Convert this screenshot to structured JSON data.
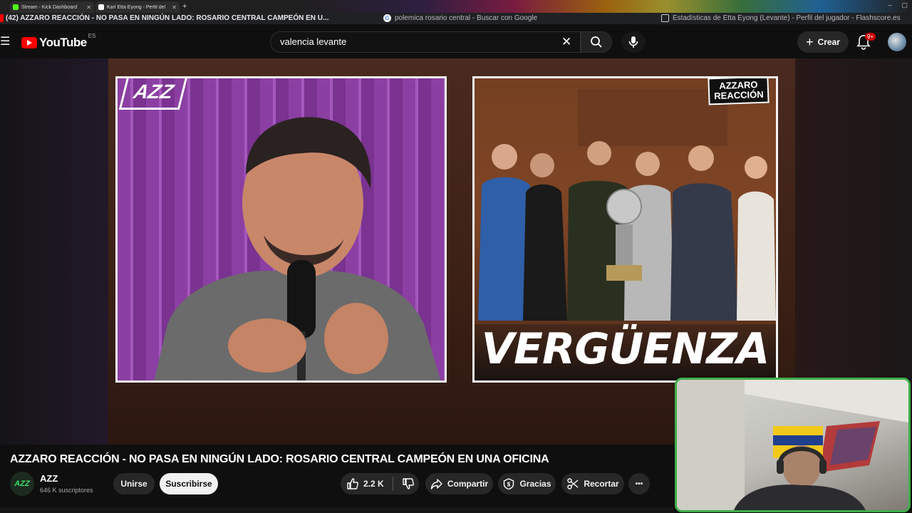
{
  "browser": {
    "tabs": [
      {
        "label": "Stream - Kick Dashboard",
        "color": "#53fc18"
      },
      {
        "label": "Karl Etta Eyong - Perfil del jugador",
        "color": "#ffffff"
      }
    ],
    "new_tab": "+",
    "row2": [
      {
        "label": "(42) AZZARO REACCIÓN - NO PASA EN NINGÚN LADO: ROSARIO CENTRAL CAMPEÓN EN U..."
      },
      {
        "label": "polemica rosario central - Buscar con Google"
      },
      {
        "label": "Estadísticas de Etta Eyong (Levante) - Perfil del jugador - Flashscore.es"
      }
    ]
  },
  "youtube": {
    "logo_word": "YouTube",
    "logo_country": "ES",
    "search_value": "valencia levante",
    "create_label": "Crear",
    "notif_badge": "9+",
    "icons": [
      "menu-icon",
      "clear-icon",
      "search-icon",
      "mic-icon",
      "plus-icon",
      "bell-icon"
    ]
  },
  "video_content": {
    "left_logo": "AZZ",
    "badge_line1": "AZZARO",
    "badge_line2": "REACCIÓN",
    "big_word": "VERGÜENZA"
  },
  "video": {
    "title": "AZZARO REACCIÓN - NO PASA EN NINGÚN LADO: ROSARIO CENTRAL CAMPEÓN EN UNA OFICINA",
    "channel_avatar": "AZZ",
    "channel_name": "AZZ",
    "subscribers": "646 K suscriptores"
  },
  "actions": {
    "join": "Unirse",
    "subscribe": "Suscribirse",
    "likes": "2.2 K",
    "share": "Compartir",
    "thanks": "Gracias",
    "clip": "Recortar",
    "more": "•••"
  },
  "colors": {
    "accent_red": "#ff0000",
    "webcam_border": "#3fae49",
    "kick_green": "#53fc18"
  }
}
